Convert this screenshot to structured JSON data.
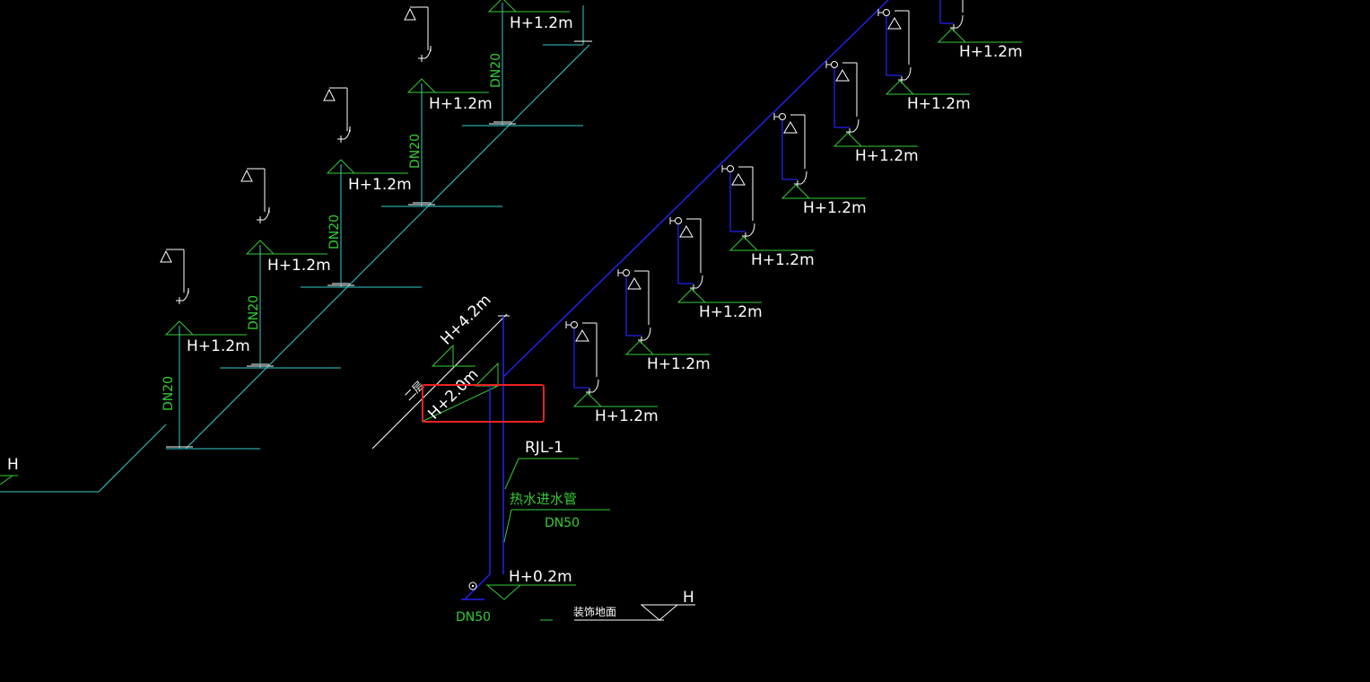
{
  "labels": {
    "elevation_fixture": "H+1.2m",
    "pipe_size_branch": "DN20",
    "elevation_top": "H+4.2m",
    "elevation_riser_branch": "H+2.0m",
    "floor_mark": "二层",
    "riser_id": "RJL-1",
    "hot_water_inlet": "热水进水管",
    "pipe_size_main": "DN50",
    "elevation_bottom": "H+0.2m",
    "pipe_size_bottom": "DN50",
    "finished_floor": "装饰地面",
    "floor_level_symbol": "H",
    "left_edge_h": "H"
  },
  "colors": {
    "background": "#000000",
    "main_pipe": "#2222ee",
    "branch_pipe": "#33cccc",
    "annotation_green": "#33cc33",
    "text_white": "#ffffff",
    "highlight_box": "#ee2222"
  },
  "highlight": {
    "target": "H+2.0m"
  }
}
